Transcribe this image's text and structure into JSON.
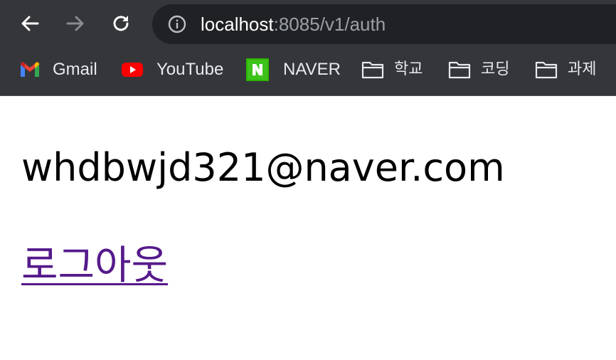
{
  "browser": {
    "nav": {
      "back_icon": "arrow-left-icon",
      "forward_icon": "arrow-right-icon",
      "reload_icon": "reload-icon"
    },
    "address_bar": {
      "host": "localhost",
      "rest": ":8085/v1/auth",
      "icon": "info-icon"
    },
    "bookmarks": [
      {
        "label": "Gmail",
        "icon": "gmail-icon"
      },
      {
        "label": "YouTube",
        "icon": "youtube-icon"
      },
      {
        "label": "NAVER",
        "icon": "naver-icon"
      },
      {
        "label": "학교",
        "icon": "folder-icon"
      },
      {
        "label": "코딩",
        "icon": "folder-icon"
      },
      {
        "label": "과제",
        "icon": "folder-icon"
      }
    ],
    "colors": {
      "toolbar_bg": "#35363a",
      "omnibox_bg": "#202124",
      "visited_link": "#551a8b"
    }
  },
  "page": {
    "email": "whdbwjd321@naver.com",
    "logout_link": "로그아웃"
  }
}
